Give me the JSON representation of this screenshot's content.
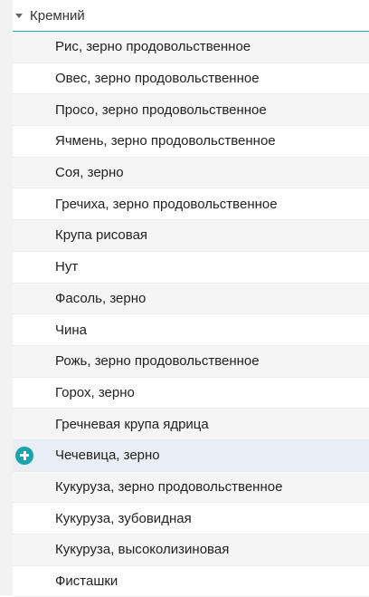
{
  "group": {
    "title": "Кремний",
    "expanded": true
  },
  "items": [
    {
      "label": "Рис, зерно продовольственное"
    },
    {
      "label": "Овес, зерно продовольственное"
    },
    {
      "label": "Просо, зерно продовольственное"
    },
    {
      "label": "Ячмень, зерно продовольственное"
    },
    {
      "label": "Соя, зерно"
    },
    {
      "label": "Гречиха, зерно продовольственное"
    },
    {
      "label": "Крупа рисовая"
    },
    {
      "label": "Нут"
    },
    {
      "label": "Фасоль, зерно"
    },
    {
      "label": "Чина"
    },
    {
      "label": "Рожь, зерно продовольственное"
    },
    {
      "label": "Горох, зерно"
    },
    {
      "label": "Гречневая крупа ядрица"
    },
    {
      "label": "Чечевица, зерно",
      "hovered": true
    },
    {
      "label": "Кукуруза, зерно продовольственное"
    },
    {
      "label": "Кукуруза, зубовидная"
    },
    {
      "label": "Кукуруза, высоколизиновая"
    },
    {
      "label": "Фисташки"
    }
  ],
  "hover_action_icon": "add-circle-icon",
  "colors": {
    "accent": "#1aa3ad",
    "divider": "#2bb3c0",
    "row_alt": "#f5f5f5",
    "row_hover": "#e9eef4"
  }
}
